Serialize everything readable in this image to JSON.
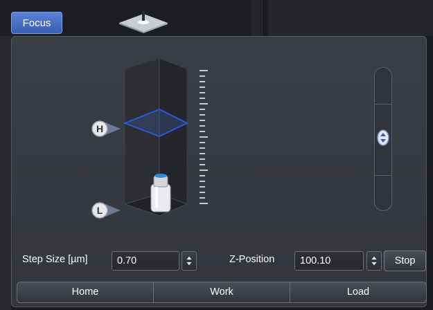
{
  "header": {
    "tab_label": "Focus"
  },
  "markers": {
    "high": "H",
    "low": "L"
  },
  "controls": {
    "step_label": "Step Size [µm]",
    "step_value": "0.70",
    "zpos_label": "Z-Position",
    "zpos_value": "100.10",
    "stop_label": "Stop"
  },
  "positions": [
    "Home",
    "Work",
    "Load"
  ],
  "colors": {
    "accent": "#4a70c8",
    "focus_plane": "#2a5ad8",
    "panel": "#383b41"
  }
}
